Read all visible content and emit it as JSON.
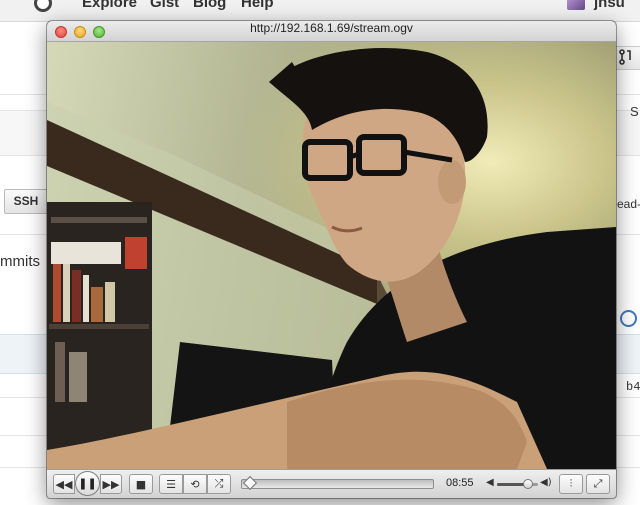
{
  "background_page": {
    "nav": [
      "Explore",
      "Gist",
      "Blog",
      "Help"
    ],
    "username": "jnsu",
    "clone_button": "SSH",
    "commits_label": "mmits",
    "right_labels": {
      "s": "S",
      "branch": "ead-",
      "hash": "b4"
    }
  },
  "player": {
    "title": "http://192.168.1.69/stream.ogv",
    "time": "08:55",
    "seek_position": 0.0,
    "volume": 0.75,
    "icons": {
      "rewind": "rewind-icon",
      "pause": "pause-icon",
      "fast_forward": "fast-forward-icon",
      "stop": "stop-icon",
      "playlist": "playlist-icon",
      "repeat": "repeat-icon",
      "shuffle": "shuffle-icon",
      "volume_low": "volume-low-icon",
      "volume_high": "volume-high-icon",
      "equalizer": "equalizer-icon",
      "fullscreen": "fullscreen-icon"
    }
  },
  "colors": {
    "close": "#e0443a",
    "minimize": "#e2a724",
    "maximize": "#53b12f",
    "link_blue": "#4078c0"
  }
}
